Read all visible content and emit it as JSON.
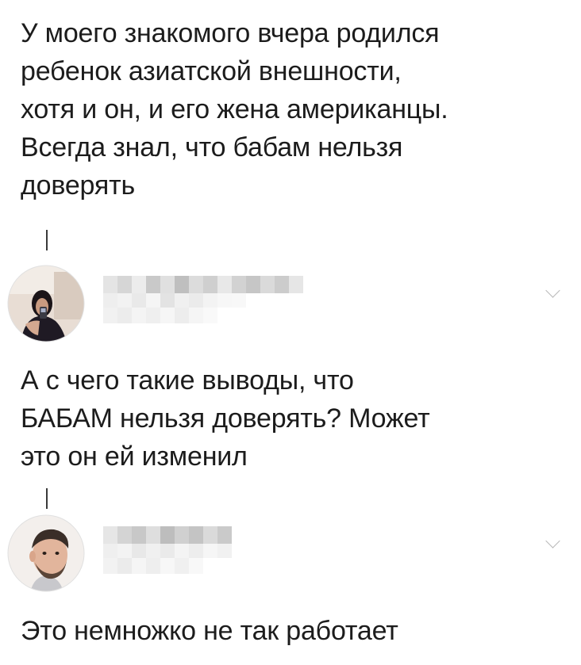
{
  "posts": [
    {
      "text": "У моего знакомого вчера родился\nребенок азиатской внешности,\nхотя и он, и его жена американцы.\nВсегда знал, что бабам нельзя\nдоверять"
    },
    {
      "text": "А с чего такие выводы, что\nБАБАМ нельзя доверять? Может\nэто он ей изменил"
    },
    {
      "text": "Это немножко не так работает"
    }
  ],
  "icons": {
    "expand": "chevron-down-icon",
    "thread": "thread-connector"
  },
  "colors": {
    "text": "#1c1c1c",
    "thread_line": "#3a3a3a",
    "chevron": "#b8b8b8",
    "background": "#ffffff"
  }
}
